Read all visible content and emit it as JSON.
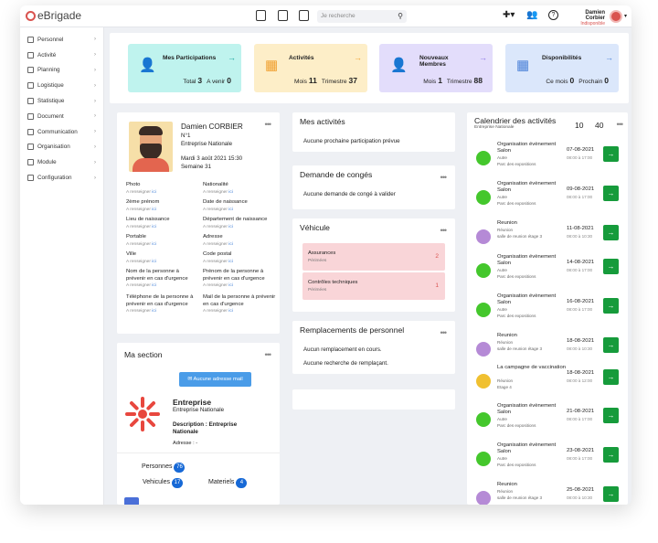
{
  "app": {
    "name": "eBrigade"
  },
  "search": {
    "placeholder": "Je recherche"
  },
  "user": {
    "name": "Damien Corbier",
    "status": "Indisponible"
  },
  "sidebar": {
    "items": [
      {
        "label": "Personnel",
        "icon": "person-icon"
      },
      {
        "label": "Activité",
        "icon": "bell-icon"
      },
      {
        "label": "Planning",
        "icon": "calendar-icon"
      },
      {
        "label": "Logistique",
        "icon": "truck-icon"
      },
      {
        "label": "Statistique",
        "icon": "chart-icon"
      },
      {
        "label": "Document",
        "icon": "document-icon"
      },
      {
        "label": "Communication",
        "icon": "mail-icon"
      },
      {
        "label": "Organisation",
        "icon": "org-icon"
      },
      {
        "label": "Module",
        "icon": "module-icon"
      },
      {
        "label": "Configuration",
        "icon": "gear-icon"
      }
    ]
  },
  "stats": [
    {
      "title": "Mes Participations",
      "k1": "Total",
      "v1": "3",
      "k2": "A venir",
      "v2": "0",
      "color": "#bff3ee",
      "accent": "#15a39a"
    },
    {
      "title": "Activités",
      "k1": "Mois",
      "v1": "11",
      "k2": "Trimestre",
      "v2": "37",
      "color": "#fdeec8",
      "accent": "#f0a030"
    },
    {
      "title": "Nouveaux Membres",
      "k1": "Mois",
      "v1": "1",
      "k2": "Trimestre",
      "v2": "88",
      "color": "#e3ddfb",
      "accent": "#8a73e6"
    },
    {
      "title": "Disponibilités",
      "k1": "Ce mois",
      "v1": "0",
      "k2": "Prochain",
      "v2": "0",
      "color": "#dbe7fb",
      "accent": "#4c82d8"
    }
  ],
  "profile": {
    "name": "Damien CORBIER",
    "number": "N°1",
    "company": "Entreprise Nationale",
    "date": "Mardi 3 août 2021 15:30",
    "week": "Semaine 31",
    "fields": [
      {
        "label": "Photo",
        "hint": "A renseigner",
        "link": "ici"
      },
      {
        "label": "Nationalité",
        "hint": "A renseigner",
        "link": "ici"
      },
      {
        "label": "2ème prénom",
        "hint": "A renseigner",
        "link": "ici"
      },
      {
        "label": "Date de naissance",
        "hint": "A renseigner",
        "link": "ici"
      },
      {
        "label": "Lieu de naissance",
        "hint": "A renseigner",
        "link": "ici"
      },
      {
        "label": "Département de naissance",
        "hint": "A renseigner",
        "link": "ici"
      },
      {
        "label": "Portable",
        "hint": "A renseigner",
        "link": "ici"
      },
      {
        "label": "Adresse",
        "hint": "A renseigner",
        "link": "ici"
      },
      {
        "label": "Ville",
        "hint": "A renseigner",
        "link": "ici"
      },
      {
        "label": "Code postal",
        "hint": "A renseigner",
        "link": "ici"
      },
      {
        "label": "Nom de la personne à prévenir en cas d'urgence",
        "hint": "A renseigner",
        "link": "ici"
      },
      {
        "label": "Prénom de la personne à prévenir en cas d'urgence",
        "hint": "A renseigner",
        "link": "ici"
      },
      {
        "label": "Téléphone de la personne à prévenir en cas d'urgence",
        "hint": "A renseigner",
        "link": "ici"
      },
      {
        "label": "Mail de la personne à prévenir en cas d'urgence",
        "hint": "A renseigner",
        "link": "ici"
      }
    ]
  },
  "section": {
    "title": "Ma section",
    "mail_button": "Aucune adresse mail",
    "name": "Entreprise",
    "sub": "Entreprise Nationale",
    "desc_label": "Description :",
    "desc_value": "Entreprise Nationale",
    "addr_label": "Adresse :",
    "addr_value": "-",
    "personnes": "Personnes",
    "personnes_n": "76",
    "vehicules": "Vehicules",
    "vehicules_n": "17",
    "materiels": "Materiels",
    "materiels_n": "4"
  },
  "activites": {
    "title": "Mes activités",
    "empty": "Aucune prochaine participation prévue"
  },
  "conges": {
    "title": "Demande de congés",
    "empty": "Aucune demande de congé à valider"
  },
  "vehicule": {
    "title": "Véhicule",
    "items": [
      {
        "label": "Assurances",
        "sub": "Périmées",
        "count": "2"
      },
      {
        "label": "Contrôles techniques",
        "sub": "Périmées",
        "count": "1"
      }
    ]
  },
  "remplacements": {
    "title": "Remplacements de personnel",
    "line1": "Aucun remplacement en cours.",
    "line2": "Aucune recherche de remplaçant."
  },
  "calendar": {
    "title": "Calendrier des activités",
    "sub": "Entreprise Nationale",
    "n1": "10",
    "n2": "40",
    "events": [
      {
        "title": "Organisation évènement Salon",
        "type": "Autre",
        "place": "Parc des expositions",
        "date": "07-08-2021",
        "time": "08:00 à 17:00",
        "dot": "#44c72c"
      },
      {
        "title": "Organisation évènement Salon",
        "type": "Autre",
        "place": "Parc des expositions",
        "date": "09-08-2021",
        "time": "08:00 à 17:00",
        "dot": "#44c72c"
      },
      {
        "title": "Reunion",
        "type": "Réunion",
        "place": "salle de reunion étage 3",
        "date": "11-08-2021",
        "time": "08:00 à 10:30",
        "dot": "#b58ad6"
      },
      {
        "title": "Organisation évènement Salon",
        "type": "Autre",
        "place": "Parc des expositions",
        "date": "14-08-2021",
        "time": "08:00 à 17:00",
        "dot": "#44c72c"
      },
      {
        "title": "Organisation évènement Salon",
        "type": "Autre",
        "place": "Parc des expositions",
        "date": "16-08-2021",
        "time": "08:00 à 17:00",
        "dot": "#44c72c"
      },
      {
        "title": "Reunion",
        "type": "Réunion",
        "place": "salle de reunion étage 3",
        "date": "18-08-2021",
        "time": "08:00 à 10:30",
        "dot": "#b58ad6"
      },
      {
        "title": "La campagne de vaccination",
        "type": "Réunion",
        "place": "Etage 4",
        "date": "18-08-2021",
        "time": "08:00 à 12:00",
        "dot": "#f0c030"
      },
      {
        "title": "Organisation évènement Salon",
        "type": "Autre",
        "place": "Parc des expositions",
        "date": "21-08-2021",
        "time": "08:00 à 17:00",
        "dot": "#44c72c"
      },
      {
        "title": "Organisation évènement Salon",
        "type": "Autre",
        "place": "Parc des expositions",
        "date": "23-08-2021",
        "time": "08:00 à 17:00",
        "dot": "#44c72c"
      },
      {
        "title": "Reunion",
        "type": "Réunion",
        "place": "salle de reunion étage 3",
        "date": "25-08-2021",
        "time": "08:00 à 10:30",
        "dot": "#b58ad6"
      }
    ]
  }
}
